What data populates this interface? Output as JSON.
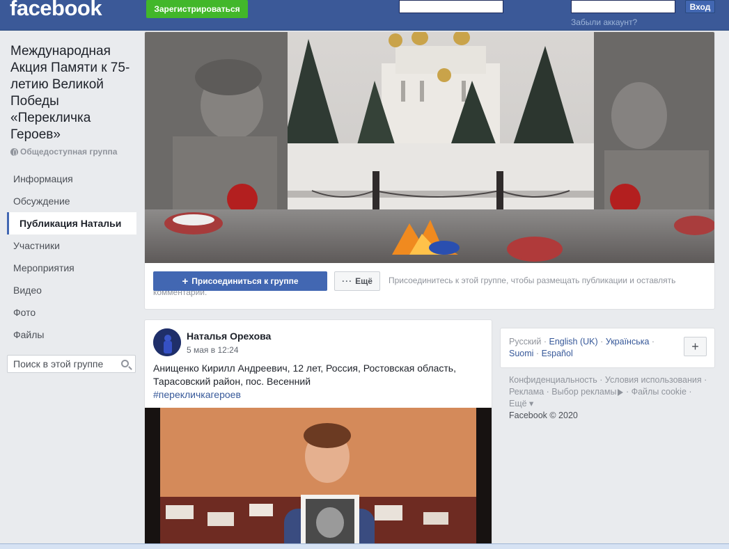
{
  "header": {
    "logo": "facebook",
    "register_label": "Зарегистрироваться",
    "login_label": "Вход",
    "forgot_label": "Забыли аккаунт?"
  },
  "group": {
    "title": "Международная Акция Памяти к 75-летию Великой Победы «Перекличка Героев»",
    "privacy": "Общедоступная группа"
  },
  "nav": {
    "items": [
      {
        "label": "Информация"
      },
      {
        "label": "Обсуждение"
      },
      {
        "label": "Публикация Натальи",
        "active": true
      },
      {
        "label": "Участники"
      },
      {
        "label": "Мероприятия"
      },
      {
        "label": "Видео"
      },
      {
        "label": "Фото"
      },
      {
        "label": "Файлы"
      }
    ]
  },
  "search": {
    "placeholder": "Поиск в этой группе"
  },
  "cover": {
    "join_label": "Присоединиться к группе",
    "more_label": "Ещё",
    "hint": "Присоединитесь к этой группе, чтобы размещать публикации и оставлять комментарии."
  },
  "post": {
    "author": "Наталья Орехова",
    "timestamp": "5 мая в 12:24",
    "text": "Анищенко Кирилл Андреевич, 12 лет, Россия, Ростовская область, Тарасовский район, пос. Весенний",
    "hashtag": "#перекличкагероев"
  },
  "languages": {
    "current": "Русский",
    "links": [
      "English (UK)",
      "Українська",
      "Suomi",
      "Español"
    ]
  },
  "footer": {
    "links": [
      "Конфиденциальность",
      "Условия использования",
      "Реклама",
      "Выбор рекламы",
      "Файлы cookie",
      "Ещё"
    ],
    "copyright": "Facebook © 2020"
  },
  "colors": {
    "header_bg": "#3b5998",
    "primary": "#4267b2",
    "register_green": "#42b72a",
    "link": "#365899",
    "page_bg": "#e9ebee"
  },
  "icons": [
    "globe-icon",
    "search-icon",
    "plus-icon",
    "dots-icon",
    "play-icon"
  ]
}
